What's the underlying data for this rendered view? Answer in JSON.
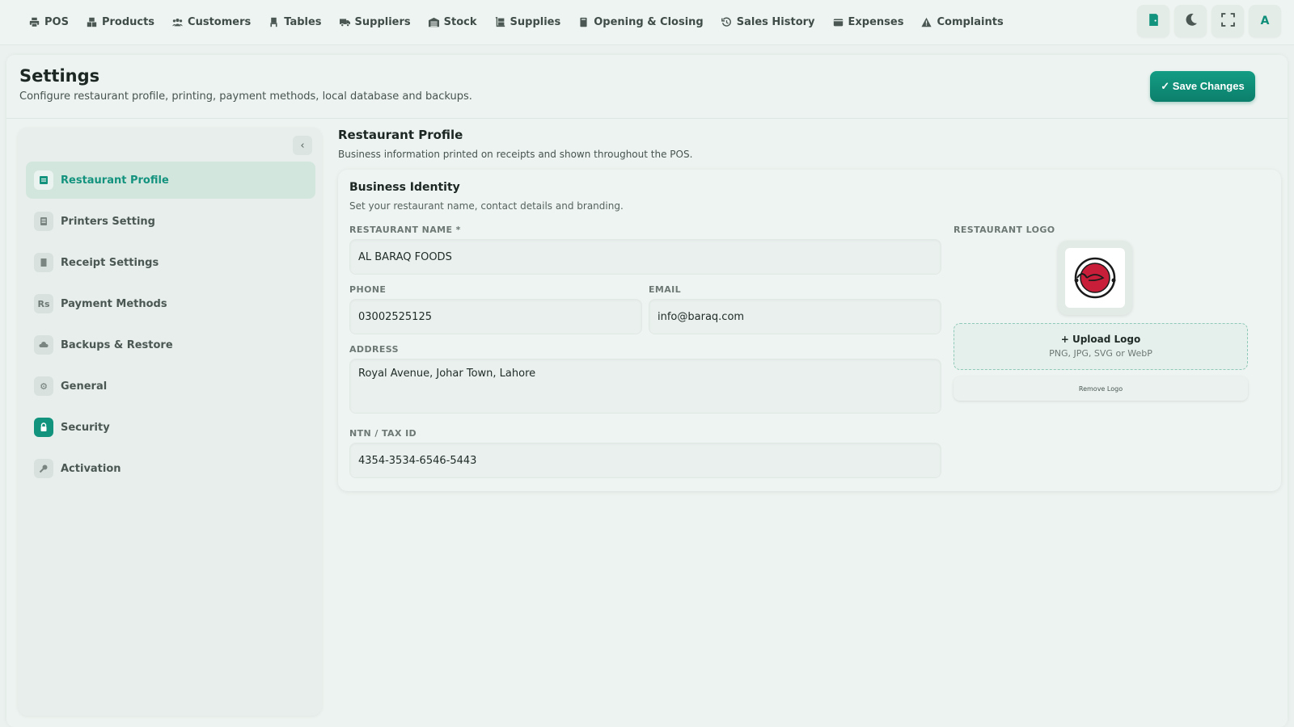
{
  "nav": {
    "items": [
      {
        "label": "POS",
        "icon": "printer-icon"
      },
      {
        "label": "Products",
        "icon": "boxes-icon"
      },
      {
        "label": "Customers",
        "icon": "users-icon"
      },
      {
        "label": "Tables",
        "icon": "chair-icon"
      },
      {
        "label": "Suppliers",
        "icon": "truck-icon"
      },
      {
        "label": "Stock",
        "icon": "warehouse-icon"
      },
      {
        "label": "Supplies",
        "icon": "dolly-icon"
      },
      {
        "label": "Opening & Closing",
        "icon": "book-icon"
      },
      {
        "label": "Sales History",
        "icon": "history-icon"
      },
      {
        "label": "Expenses",
        "icon": "wallet-icon"
      },
      {
        "label": "Complaints",
        "icon": "warning-icon"
      }
    ],
    "tools": {
      "avatar": "A"
    }
  },
  "header": {
    "title": "Settings",
    "subtitle": "Configure restaurant profile, printing, payment methods, local database and backups.",
    "save_label": "✓ Save Changes"
  },
  "sidebar": {
    "collapse": "‹",
    "items": [
      {
        "label": "Restaurant Profile",
        "icon_text": ""
      },
      {
        "label": "Printers Setting",
        "icon_text": ""
      },
      {
        "label": "Receipt Settings",
        "icon_text": ""
      },
      {
        "label": "Payment Methods",
        "icon_text": "Rs"
      },
      {
        "label": "Backups & Restore",
        "icon_text": ""
      },
      {
        "label": "General",
        "icon_text": "⚙"
      },
      {
        "label": "Security",
        "icon_text": ""
      },
      {
        "label": "Activation",
        "icon_text": ""
      }
    ]
  },
  "profile": {
    "title": "Restaurant Profile",
    "subtitle": "Business information printed on receipts and shown throughout the POS.",
    "card_title": "Business Identity",
    "card_subtitle": "Set your restaurant name, contact details and branding.",
    "fields": {
      "name_label": "RESTAURANT NAME *",
      "name_value": "AL BARAQ FOODS",
      "phone_label": "PHONE",
      "phone_value": "03002525125",
      "email_label": "EMAIL",
      "email_value": "info@baraq.com",
      "address_label": "ADDRESS",
      "address_value": "Royal Avenue, Johar Town, Lahore",
      "ntn_label": "NTN / TAX ID",
      "ntn_value": "4354-3534-6546-5443"
    },
    "logo": {
      "label": "RESTAURANT LOGO",
      "upload_title": "+ Upload Logo",
      "upload_sub": "PNG, JPG, SVG or WebP",
      "remove_label": "Remove Logo"
    }
  },
  "colors": {
    "accent": "#12937e",
    "background": "#eaf1ee"
  }
}
